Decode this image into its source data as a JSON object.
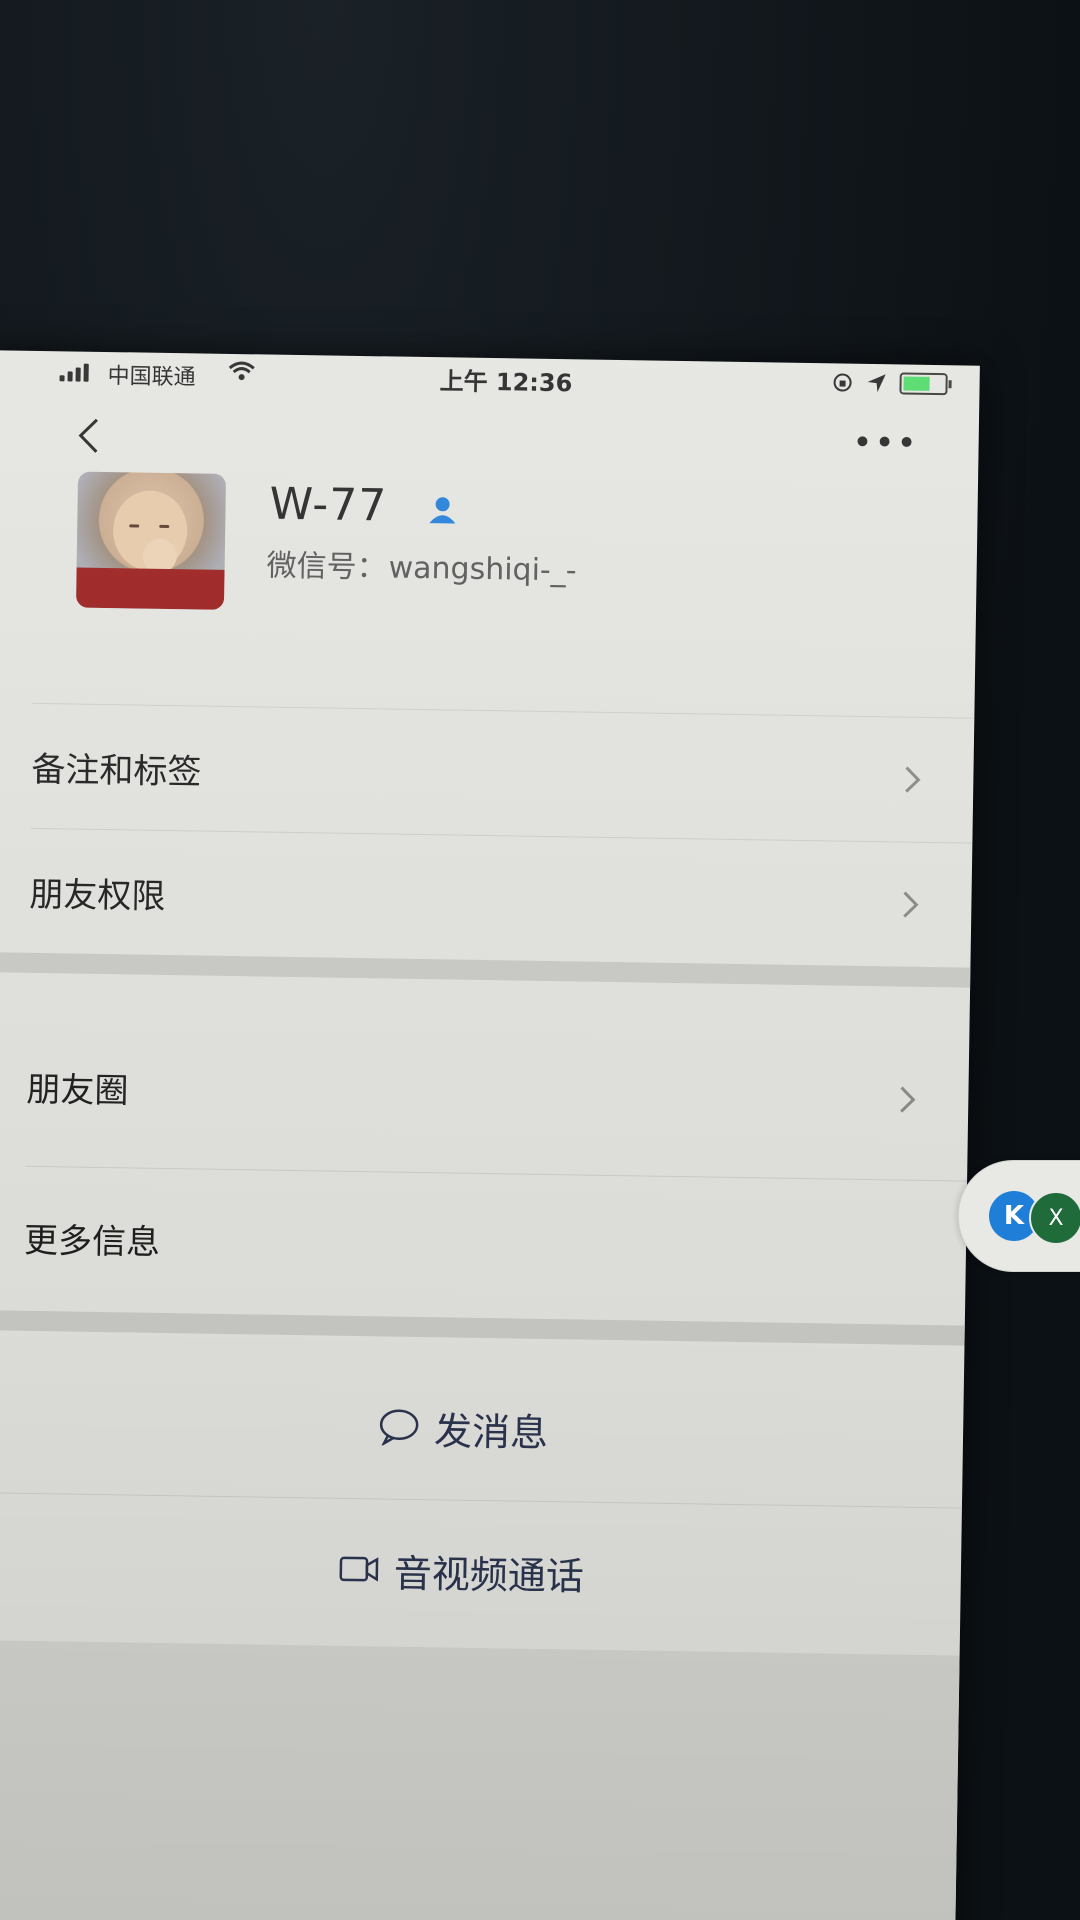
{
  "status_bar": {
    "carrier": "中国联通",
    "time": "上午 12:36"
  },
  "profile": {
    "name": "W-77",
    "wechat_id_label": "微信号：",
    "wechat_id": "wangshiqi-_-"
  },
  "menu": {
    "remark_tags": "备注和标签",
    "friend_permissions": "朋友权限",
    "moments": "朋友圈",
    "more_info": "更多信息"
  },
  "actions": {
    "send_message": "发消息",
    "video_call": "音视频通话"
  },
  "floating_bubble": {
    "a_label": "K",
    "b_label": "X"
  },
  "icons": {
    "back": "chevron-left-icon",
    "more": "more-dots-icon",
    "person": "person-icon",
    "chevron": "chevron-right-icon",
    "chat": "chat-bubble-icon",
    "video": "video-camera-icon"
  },
  "colors": {
    "screen_bg": "#e4e4e0",
    "action_text": "#2c3550",
    "verified_blue": "#1f7ed8",
    "battery_green": "#4cd964"
  }
}
